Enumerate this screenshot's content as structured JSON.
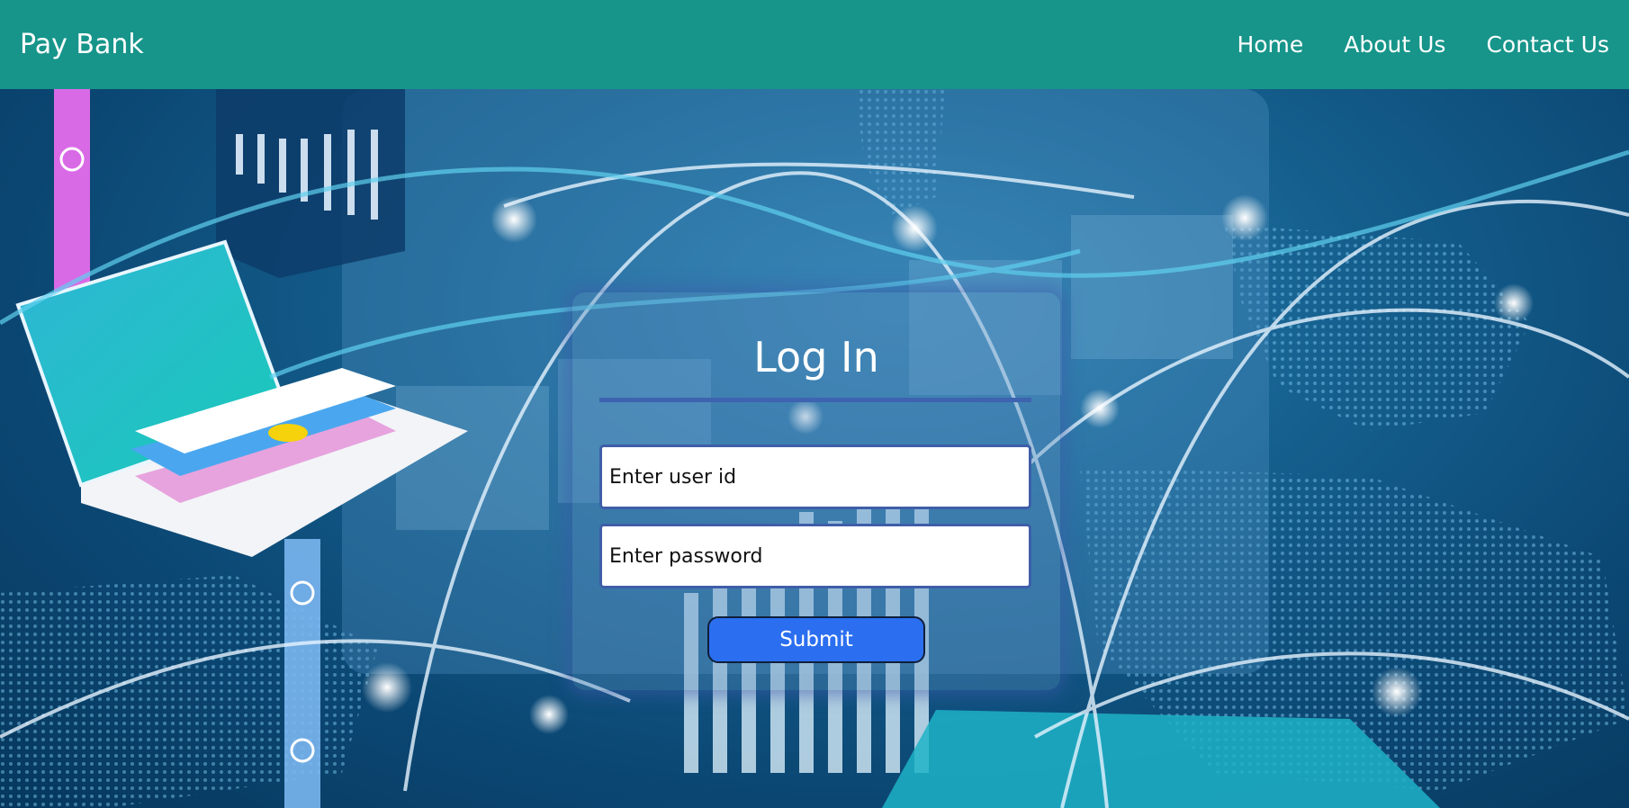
{
  "navbar": {
    "brand": "Pay Bank",
    "links": [
      "Home",
      "About Us",
      "Contact Us"
    ]
  },
  "login": {
    "title": "Log In",
    "user_placeholder": "Enter user id",
    "password_placeholder": "Enter password",
    "submit_label": "Submit"
  },
  "colors": {
    "navbar": "#17958a",
    "submit": "#2b6ff0",
    "card_accent": "#3e63b0"
  }
}
